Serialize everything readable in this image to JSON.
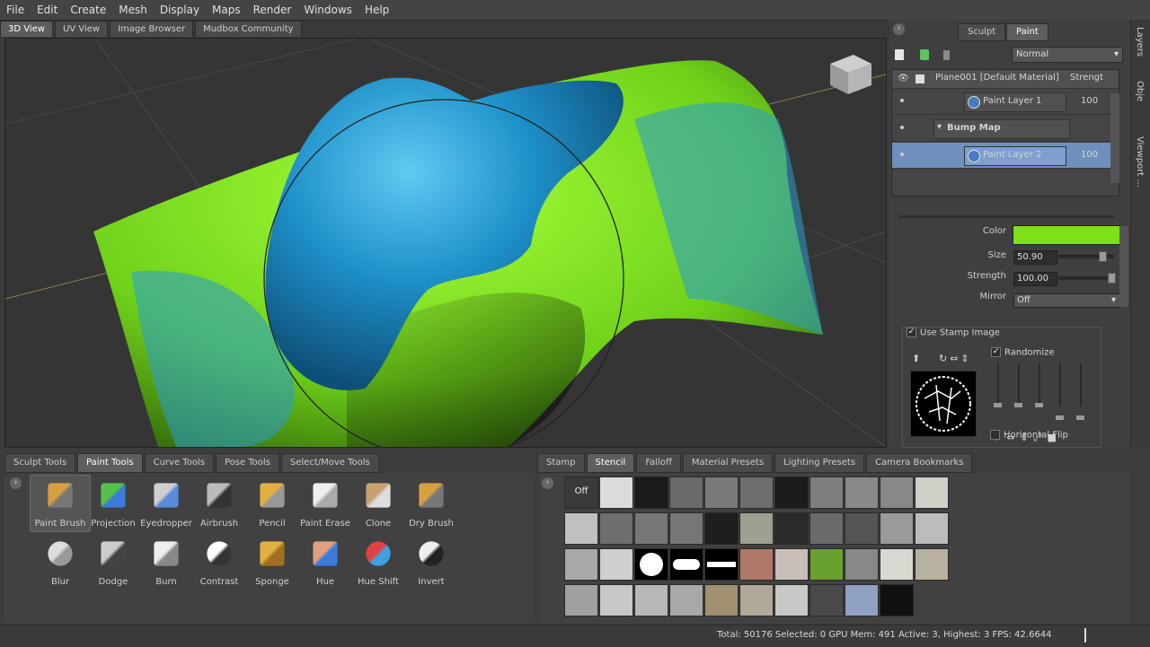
{
  "menu": [
    "File",
    "Edit",
    "Create",
    "Mesh",
    "Display",
    "Maps",
    "Render",
    "Windows",
    "Help"
  ],
  "view_tabs": [
    {
      "label": "3D View",
      "active": true
    },
    {
      "label": "UV View",
      "active": false
    },
    {
      "label": "Image Browser",
      "active": false
    },
    {
      "label": "Mudbox Community",
      "active": false
    }
  ],
  "right_panel": {
    "modes": [
      {
        "label": "Sculpt",
        "active": false
      },
      {
        "label": "Paint",
        "active": true
      }
    ],
    "blend_mode": "Normal",
    "layers_header": {
      "name": "Plane001 [Default Material]",
      "strength": "Strengt"
    },
    "layers": [
      {
        "name": "Paint Layer 1",
        "value": "100",
        "selected": false,
        "type": "layer"
      },
      {
        "name": "Bump Map",
        "value": "",
        "selected": false,
        "type": "group"
      },
      {
        "name": "Paint Layer 2",
        "value": "100",
        "selected": true,
        "type": "layer"
      }
    ],
    "properties": {
      "color_label": "Color",
      "color_value": "#7ee01a",
      "size_label": "Size",
      "size_value": "50.90",
      "size_level": 0.78,
      "strength_label": "Strength",
      "strength_value": "100.00",
      "strength_level": 1.0,
      "mirror_label": "Mirror",
      "mirror_value": "Off",
      "use_stamp_label": "Use Stamp Image",
      "randomize_label": "Randomize",
      "horizontal_flip_label": "Horizontal Flip"
    },
    "side_tabs": [
      "Layers",
      "Obje",
      "Viewport ..."
    ]
  },
  "tool_tabs": [
    {
      "label": "Sculpt Tools",
      "active": false
    },
    {
      "label": "Paint Tools",
      "active": true
    },
    {
      "label": "Curve Tools",
      "active": false
    },
    {
      "label": "Pose Tools",
      "active": false
    },
    {
      "label": "Select/Move Tools",
      "active": false
    }
  ],
  "tools": [
    {
      "label": "Paint Brush",
      "icon": "paint-brush-icon",
      "active": true
    },
    {
      "label": "Projection",
      "icon": "projection-icon",
      "active": false
    },
    {
      "label": "Eyedropper",
      "icon": "eyedropper-icon",
      "active": false
    },
    {
      "label": "Airbrush",
      "icon": "airbrush-icon",
      "active": false
    },
    {
      "label": "Pencil",
      "icon": "pencil-icon",
      "active": false
    },
    {
      "label": "Paint Erase",
      "icon": "paint-erase-icon",
      "active": false
    },
    {
      "label": "Clone",
      "icon": "clone-icon",
      "active": false
    },
    {
      "label": "Dry Brush",
      "icon": "dry-brush-icon",
      "active": false
    },
    {
      "label": "Blur",
      "icon": "blur-icon",
      "active": false
    },
    {
      "label": "Dodge",
      "icon": "dodge-icon",
      "active": false
    },
    {
      "label": "Burn",
      "icon": "burn-icon",
      "active": false
    },
    {
      "label": "Contrast",
      "icon": "contrast-icon",
      "active": false
    },
    {
      "label": "Sponge",
      "icon": "sponge-icon",
      "active": false
    },
    {
      "label": "Hue",
      "icon": "hue-icon",
      "active": false
    },
    {
      "label": "Hue Shift",
      "icon": "hue-shift-icon",
      "active": false
    },
    {
      "label": "Invert",
      "icon": "invert-icon",
      "active": false
    }
  ],
  "texture_tabs": [
    {
      "label": "Stamp",
      "active": false
    },
    {
      "label": "Stencil",
      "active": true
    },
    {
      "label": "Falloff",
      "active": false
    },
    {
      "label": "Material Presets",
      "active": false
    },
    {
      "label": "Lighting Presets",
      "active": false
    },
    {
      "label": "Camera Bookmarks",
      "active": false
    }
  ],
  "stencil_off_label": "Off",
  "status": "Total: 50176  Selected: 0 GPU Mem: 491  Active: 3, Highest: 3  FPS: 42.6644",
  "colors": {
    "paint_green": "#7ee01a",
    "paint_blue": "#1e8fc8",
    "selection": "#6f8fbd"
  }
}
